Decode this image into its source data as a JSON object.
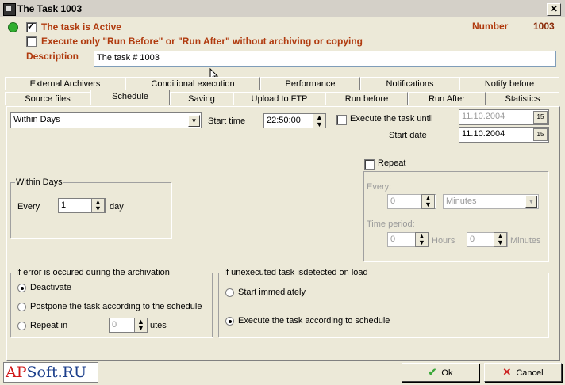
{
  "window": {
    "title": "The Task 1003",
    "close_label": "✕"
  },
  "header": {
    "active_label": "The task is Active",
    "run_only_label": "Execute only \"Run Before\" or \"Run After\" without archiving or copying",
    "number_label": "Number",
    "number_value": "1003",
    "description_label": "Description",
    "description_value": "The task # 1003"
  },
  "tabs": {
    "row_top": [
      "External Archivers",
      "Conditional execution",
      "Performance",
      "Notifications",
      "Notify before"
    ],
    "row_bottom": [
      "Source files",
      "Schedule",
      "Saving",
      "Upload to FTP",
      "Run before",
      "Run After",
      "Statistics"
    ],
    "active": "Schedule"
  },
  "schedule": {
    "mode_value": "Within Days",
    "start_time_label": "Start time",
    "start_time_value": "22:50:00",
    "execute_until_label": "Execute the task until",
    "execute_until_value": "11.10.2004",
    "start_date_label": "Start date",
    "start_date_value": "11.10.2004"
  },
  "within_days": {
    "group_label": "Within Days",
    "every_label": "Every",
    "every_value": "1",
    "unit_label": "day"
  },
  "repeat": {
    "label": "Repeat",
    "every_label": "Every:",
    "every_value": "0",
    "every_unit": "Minutes",
    "period_label": "Time period:",
    "hours_value": "0",
    "hours_label": "Hours",
    "minutes_value": "0",
    "minutes_label": "Minutes"
  },
  "error_group": {
    "label": "If error is occured during the archivation",
    "opt_deactivate": "Deactivate",
    "opt_postpone": "Postpone the task according to the schedule",
    "opt_repeat": "Repeat in",
    "repeat_value": "0",
    "repeat_unit": "utes"
  },
  "unexecuted_group": {
    "label": "If unexecuted task isdetected on load",
    "opt_start": "Start immediately",
    "opt_schedule": "Execute the task according to schedule"
  },
  "footer": {
    "logo_ap": "AP",
    "logo_rest": "Soft.RU",
    "ok_label": "Ok",
    "cancel_label": "Cancel"
  }
}
